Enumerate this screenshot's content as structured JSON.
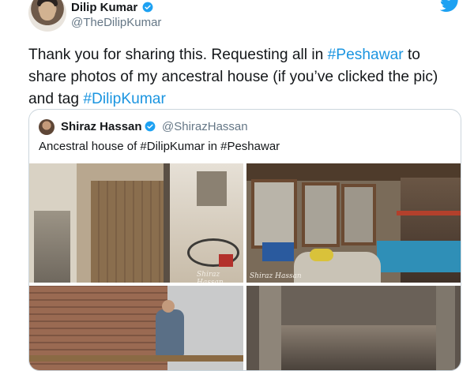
{
  "tweet": {
    "author_name": "Dilip Kumar",
    "author_handle": "@TheDilipKumar",
    "text_parts": {
      "t1": "Thank you for sharing this. Requesting all in ",
      "h1": "#Peshawar",
      "t2": " to share photos of my ancestral house (if you’ve clicked the pic) and tag ",
      "h2": "#DilipKumar"
    }
  },
  "quoted": {
    "author_name": "Shiraz Hassan",
    "author_handle": "@ShirazHassan",
    "text": "Ancestral house of #DilipKumar in #Peshawar",
    "photos": [
      {
        "watermark": "Shiraz Hassan",
        "subject": "doorway-alley"
      },
      {
        "watermark": "Shiraz Hassan",
        "subject": "interior-room"
      },
      {
        "watermark": "",
        "subject": "brick-wall-workers"
      },
      {
        "watermark": "",
        "subject": "rubble-interior"
      }
    ]
  },
  "icons": {
    "verified": "verified-badge-icon",
    "brand": "twitter-bird-icon"
  },
  "colors": {
    "hashtag": "#1b95e0",
    "verified": "#1da1f2",
    "muted": "#657786",
    "border": "#ccd6dd"
  }
}
